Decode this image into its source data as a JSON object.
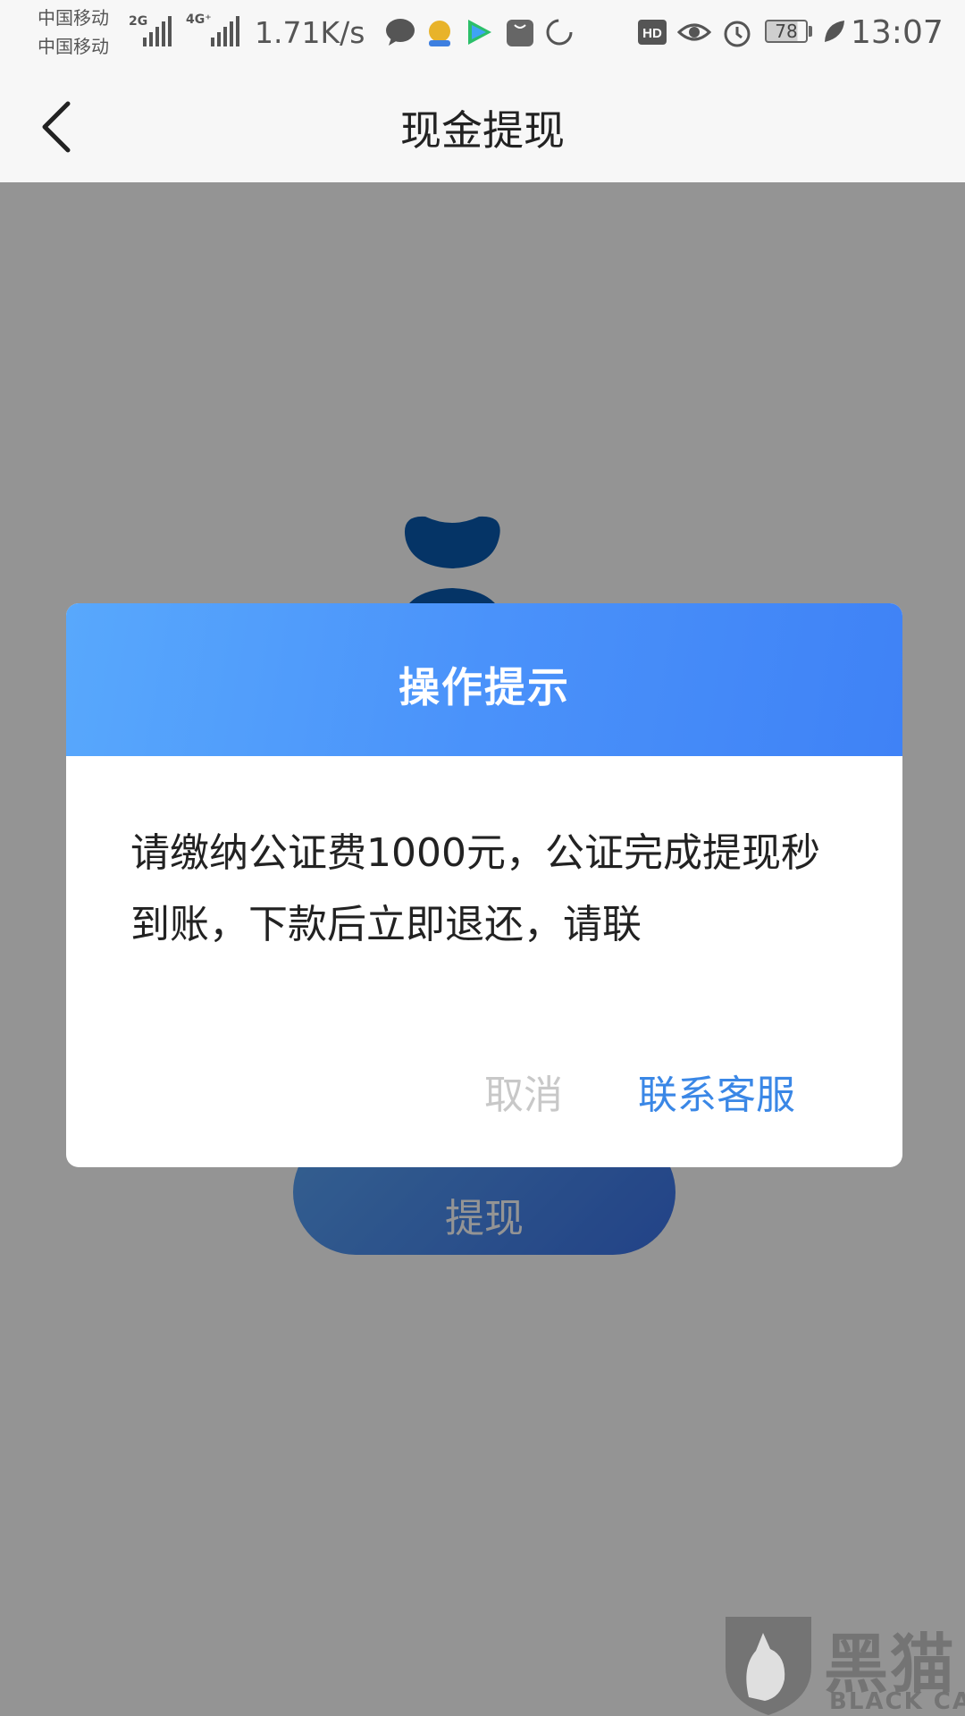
{
  "status_bar": {
    "carrier_1": "中国移动",
    "carrier_2": "中国移动",
    "network_1": "2G",
    "network_2": "4G⁺",
    "speed": "1.71K/s",
    "battery": "78",
    "time": "13:07",
    "hd_label": "HD",
    "icons": [
      "message-icon",
      "money-bag-app-icon",
      "video-app-icon",
      "huawei-app-icon",
      "loading-icon",
      "hd-icon",
      "eye-icon",
      "alarm-icon",
      "leaf-icon"
    ]
  },
  "nav": {
    "title": "现金提现"
  },
  "page": {
    "withdraw_label": "提现"
  },
  "dialog": {
    "title": "操作提示",
    "message": "请缴纳公证费1000元，公证完成提现秒到账，下款后立即退还，请联",
    "cancel_label": "取消",
    "contact_label": "联系客服"
  },
  "watermark": {
    "cn": "黑猫",
    "en": "BLACK CAT"
  },
  "colors": {
    "dialog_header_start": "#58a8fc",
    "dialog_header_end": "#3f82f6",
    "contact_link": "#3a87e6",
    "cancel_text": "#c8c8c8",
    "bag_color": "#0a5bb0"
  }
}
